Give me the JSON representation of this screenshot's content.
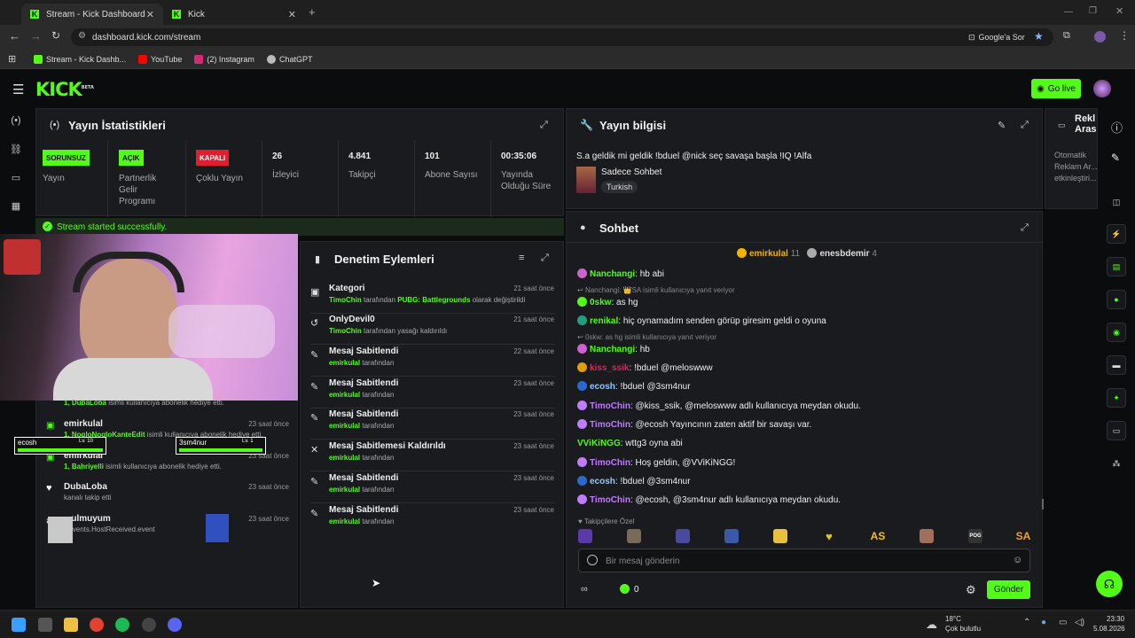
{
  "browser": {
    "tabs": [
      {
        "label": "Stream - Kick Dashboard"
      },
      {
        "label": "Kick"
      }
    ],
    "url": "dashboard.kick.com/stream",
    "google_btn": "Google'a Sor",
    "bookmarks": [
      {
        "label": "Stream - Kick Dashb...",
        "color": "#53fc18"
      },
      {
        "label": "YouTube",
        "color": "#ff0000"
      },
      {
        "label": "(2) Instagram",
        "color": "#d62976"
      },
      {
        "label": "ChatGPT",
        "color": "#bbbbbb"
      }
    ]
  },
  "kick": {
    "logo": "KICK",
    "logo_beta": "BETA",
    "go_live": "Go live"
  },
  "stats": {
    "title": "Yayın İstatistikleri",
    "items": [
      {
        "badge": "SORUNSUZ",
        "label": "Yayın"
      },
      {
        "badge": "AÇIK",
        "label": "Partnerlik Gelir Programı"
      },
      {
        "badge": "KAPALI",
        "label": "Çoklu Yayın"
      },
      {
        "value": "26",
        "label": "İzleyici"
      },
      {
        "value": "4.841",
        "label": "Takipçi"
      },
      {
        "value": "101",
        "label": "Abone Sayısı"
      },
      {
        "value": "00:35:06",
        "label": "Yayında Olduğu Süre"
      }
    ],
    "success": "Stream started successfully."
  },
  "info": {
    "title": "Yayın bilgisi",
    "stream_title": "S.a geldik mi geldik !bduel @nick seç savaşa başla !IQ !Alfa",
    "category": "Sadece Sohbet",
    "tag": "Turkish"
  },
  "ads": {
    "title": "Rekl Arası",
    "text": "Otomatik Reklam Ar... etkinleştiri..."
  },
  "mod": {
    "title": "Denetim Eylemleri",
    "items": [
      {
        "title": "Kategori",
        "user": "TimoChin",
        "rest": " tarafından ",
        "bold2": "PUBG: Battlegrounds",
        "rest2": " olarak değiştirildi",
        "time": "21 saat önce",
        "icon": "▣"
      },
      {
        "title": "OnlyDevil0",
        "user": "TimoChin",
        "rest": " tarafından yasağı kaldırıldı",
        "bold2": "",
        "rest2": "",
        "time": "21 saat önce",
        "icon": "↺"
      },
      {
        "title": "Mesaj Sabitlendi",
        "user": "emirkulal",
        "rest": " tarafından",
        "bold2": "",
        "rest2": "",
        "time": "22 saat önce",
        "icon": "✎"
      },
      {
        "title": "Mesaj Sabitlendi",
        "user": "emirkulal",
        "rest": " tarafından",
        "bold2": "",
        "rest2": "",
        "time": "23 saat önce",
        "icon": "✎"
      },
      {
        "title": "Mesaj Sabitlendi",
        "user": "emirkulal",
        "rest": " tarafından",
        "bold2": "",
        "rest2": "",
        "time": "23 saat önce",
        "icon": "✎"
      },
      {
        "title": "Mesaj Sabitlemesi Kaldırıldı",
        "user": "emirkulal",
        "rest": " tarafından",
        "bold2": "",
        "rest2": "",
        "time": "23 saat önce",
        "icon": "✕"
      },
      {
        "title": "Mesaj Sabitlendi",
        "user": "emirkulal",
        "rest": " tarafından",
        "bold2": "",
        "rest2": "",
        "time": "23 saat önce",
        "icon": "✎"
      },
      {
        "title": "Mesaj Sabitlendi",
        "user": "emirkulal",
        "rest": " tarafından",
        "bold2": "",
        "rest2": "",
        "time": "23 saat önce",
        "icon": "✎"
      }
    ]
  },
  "activity": {
    "items": [
      {
        "name": "",
        "user": "1, DubaLoba",
        "rest": " isimli kullanıcıya abonelik hediye etti.",
        "time": ""
      },
      {
        "name": "emirkulal",
        "user": "1, NogloNogloKanteEdit",
        "rest": " isimli kullanıcıya abonelik hediye etti.",
        "time": "23 saat önce"
      },
      {
        "name": "emirkulal",
        "user": "1, Bahriyelli",
        "rest": " isimli kullanıcıya abonelik hediye etti.",
        "time": "23 saat önce"
      },
      {
        "name": "DubaLoba",
        "user": "",
        "rest": "kanalı takip etti",
        "time": "23 saat önce"
      },
      {
        "name": "...ulmuyum",
        "user": "",
        "rest": "dEvents.HostReceived.event",
        "time": "23 saat önce"
      }
    ],
    "overlay1": {
      "name": "ecosh",
      "level": "Lv. 10"
    },
    "overlay2": {
      "name": "3sm4nur",
      "level": "Lv. 1"
    }
  },
  "chat": {
    "title": "Sohbet",
    "top": [
      {
        "name": "emirkulal",
        "count": "11"
      },
      {
        "name": "enesbdemir",
        "count": "4"
      }
    ],
    "messages": [
      {
        "user": "Nanchangi",
        "color": "#53fc18",
        "text": "hb abi"
      },
      {
        "reply": "Nanchangi: 👑SA isimli kullanıcıya yanıt veriyor"
      },
      {
        "user": "0skw",
        "color": "#53fc18",
        "text": "as hg"
      },
      {
        "user": "renikal",
        "color": "#53fc18",
        "text": "hiç oynamadım senden görüp giresim geldi o oyuna"
      },
      {
        "reply": "0skw: as hg isimli kullanıcıya yanıt veriyor"
      },
      {
        "user": "Nanchangi",
        "color": "#53fc18",
        "text": "hb"
      },
      {
        "user": "kiss_ssik",
        "color": "#e0245e",
        "text": "!bduel @meloswww"
      },
      {
        "user": "ecosh",
        "color": "#8fc9ff",
        "text": "!bduel @3sm4nur"
      },
      {
        "user": "TimoChin",
        "color": "#c07bff",
        "text": "@kiss_ssik, @meloswww adlı kullanıcıya meydan okudu."
      },
      {
        "user": "TimoChin",
        "color": "#c07bff",
        "text": "@ecosh Yayıncının zaten aktif bir savaşı var."
      },
      {
        "user": "VViKiNGG",
        "color": "#53fc18",
        "text": "wttg3 oyna abi"
      },
      {
        "user": "TimoChin",
        "color": "#c07bff",
        "text": "Hoş geldin, @VViKiNGG!"
      },
      {
        "user": "ecosh",
        "color": "#8fc9ff",
        "text": "!bduel @3sm4nur"
      },
      {
        "user": "TimoChin",
        "color": "#c07bff",
        "text": "@ecosh, @3sm4nur adlı kullanıcıya meydan okudu."
      }
    ],
    "follower_label": "Takipçilere Özel",
    "emotes": [
      "AS",
      "SA"
    ],
    "placeholder": "Bir mesaj gönderin",
    "send": "Gönder",
    "viewers": "0"
  },
  "taskbar": {
    "weather_temp": "18°C",
    "weather_desc": "Çok bulutlu",
    "time": "23:30",
    "date": "5.08.2026"
  }
}
